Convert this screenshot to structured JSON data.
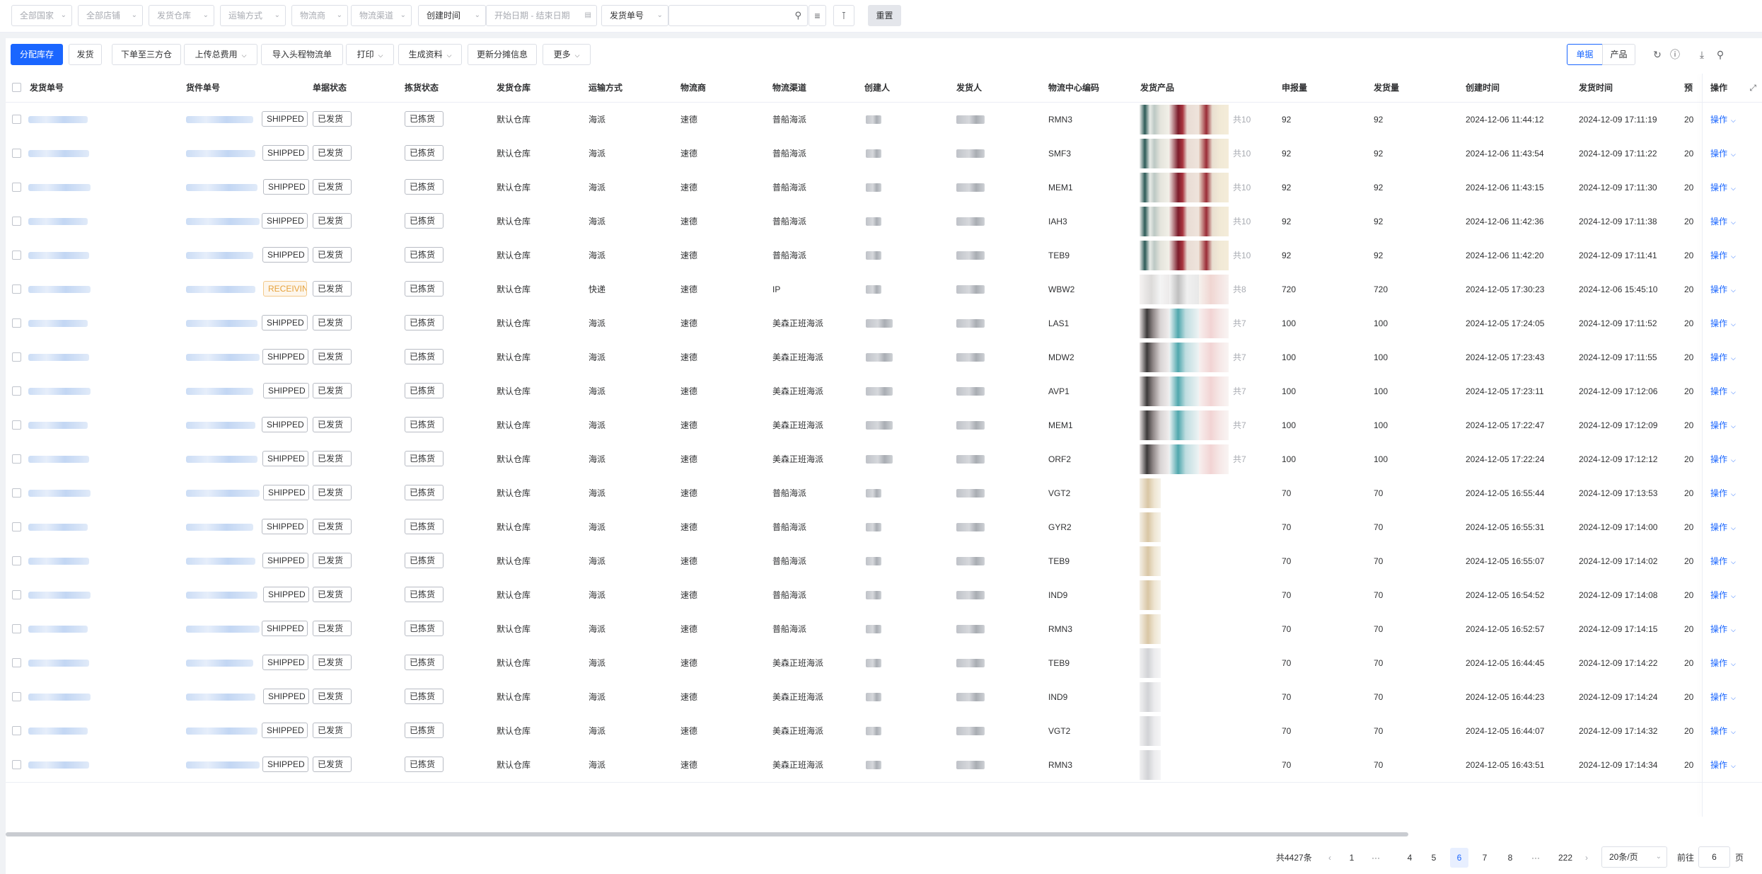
{
  "filters": {
    "country": "全部国家",
    "shop": "全部店铺",
    "warehouse": "发货仓库",
    "shipping_method": "运输方式",
    "carrier": "物流商",
    "channel": "物流渠道",
    "time_type": "创建时间",
    "date_range": "开始日期 - 结束日期",
    "search_field": "发货单号",
    "search_value": "",
    "reset": "重置"
  },
  "toolbar": {
    "allocate": "分配库存",
    "ship": "发货",
    "order_third": "下单至三方仓",
    "upload_fee": "上传总费用",
    "import_tracking": "导入头程物流单",
    "print": "打印",
    "generate": "生成资料",
    "update_split": "更新分摊信息",
    "more": "更多",
    "view_single": "单据",
    "view_product": "产品"
  },
  "columns": [
    "发货单号",
    "货件单号",
    "单据状态",
    "拣货状态",
    "发货仓库",
    "运输方式",
    "物流商",
    "物流渠道",
    "创建人",
    "发货人",
    "物流中心编码",
    "发货产品",
    "申报量",
    "发货量",
    "创建时间",
    "发货时间",
    "预",
    "操作"
  ],
  "row_action": "操作",
  "rows": [
    {
      "status": "SHIPPED",
      "doc_status": "已发货",
      "pick": "已拣货",
      "wh": "默认仓库",
      "method": "海派",
      "carrier": "速德",
      "channel": "普船海派",
      "center": "RMN3",
      "thumbs": [
        "t1",
        "t2",
        "t3"
      ],
      "count": "共10",
      "declared": "92",
      "shipped": "92",
      "created": "2024-12-06 11:44:12",
      "ship_time": "2024-12-09 17:11:19",
      "pre": "20"
    },
    {
      "status": "SHIPPED",
      "doc_status": "已发货",
      "pick": "已拣货",
      "wh": "默认仓库",
      "method": "海派",
      "carrier": "速德",
      "channel": "普船海派",
      "center": "SMF3",
      "thumbs": [
        "t1",
        "t2",
        "t3"
      ],
      "count": "共10",
      "declared": "92",
      "shipped": "92",
      "created": "2024-12-06 11:43:54",
      "ship_time": "2024-12-09 17:11:22",
      "pre": "20"
    },
    {
      "status": "SHIPPED",
      "doc_status": "已发货",
      "pick": "已拣货",
      "wh": "默认仓库",
      "method": "海派",
      "carrier": "速德",
      "channel": "普船海派",
      "center": "MEM1",
      "thumbs": [
        "t1",
        "t2",
        "t3"
      ],
      "count": "共10",
      "declared": "92",
      "shipped": "92",
      "created": "2024-12-06 11:43:15",
      "ship_time": "2024-12-09 17:11:30",
      "pre": "20"
    },
    {
      "status": "SHIPPED",
      "doc_status": "已发货",
      "pick": "已拣货",
      "wh": "默认仓库",
      "method": "海派",
      "carrier": "速德",
      "channel": "普船海派",
      "center": "IAH3",
      "thumbs": [
        "t1",
        "t2",
        "t3"
      ],
      "count": "共10",
      "declared": "92",
      "shipped": "92",
      "created": "2024-12-06 11:42:36",
      "ship_time": "2024-12-09 17:11:38",
      "pre": "20"
    },
    {
      "status": "SHIPPED",
      "doc_status": "已发货",
      "pick": "已拣货",
      "wh": "默认仓库",
      "method": "海派",
      "carrier": "速德",
      "channel": "普船海派",
      "center": "TEB9",
      "thumbs": [
        "t1",
        "t2",
        "t3"
      ],
      "count": "共10",
      "declared": "92",
      "shipped": "92",
      "created": "2024-12-06 11:42:20",
      "ship_time": "2024-12-09 17:11:41",
      "pre": "20"
    },
    {
      "status": "RECEIVIN",
      "doc_status": "已发货",
      "pick": "已拣货",
      "wh": "默认仓库",
      "method": "快递",
      "carrier": "速德",
      "channel": "IP",
      "center": "WBW2",
      "thumbs": [
        "t4",
        "t5",
        "t6"
      ],
      "count": "共8",
      "declared": "720",
      "shipped": "720",
      "created": "2024-12-05 17:30:23",
      "ship_time": "2024-12-06 15:45:10",
      "pre": "20"
    },
    {
      "status": "SHIPPED",
      "doc_status": "已发货",
      "pick": "已拣货",
      "wh": "默认仓库",
      "method": "海派",
      "carrier": "速德",
      "channel": "美森正班海派",
      "center": "LAS1",
      "thumbs": [
        "t7",
        "t8",
        "t9"
      ],
      "count": "共7",
      "declared": "100",
      "shipped": "100",
      "created": "2024-12-05 17:24:05",
      "ship_time": "2024-12-09 17:11:52",
      "pre": "20"
    },
    {
      "status": "SHIPPED",
      "doc_status": "已发货",
      "pick": "已拣货",
      "wh": "默认仓库",
      "method": "海派",
      "carrier": "速德",
      "channel": "美森正班海派",
      "center": "MDW2",
      "thumbs": [
        "t7",
        "t8",
        "t9"
      ],
      "count": "共7",
      "declared": "100",
      "shipped": "100",
      "created": "2024-12-05 17:23:43",
      "ship_time": "2024-12-09 17:11:55",
      "pre": "20"
    },
    {
      "status": "SHIPPED",
      "doc_status": "已发货",
      "pick": "已拣货",
      "wh": "默认仓库",
      "method": "海派",
      "carrier": "速德",
      "channel": "美森正班海派",
      "center": "AVP1",
      "thumbs": [
        "t7",
        "t8",
        "t9"
      ],
      "count": "共7",
      "declared": "100",
      "shipped": "100",
      "created": "2024-12-05 17:23:11",
      "ship_time": "2024-12-09 17:12:06",
      "pre": "20"
    },
    {
      "status": "SHIPPED",
      "doc_status": "已发货",
      "pick": "已拣货",
      "wh": "默认仓库",
      "method": "海派",
      "carrier": "速德",
      "channel": "美森正班海派",
      "center": "MEM1",
      "thumbs": [
        "t7",
        "t8",
        "t9"
      ],
      "count": "共7",
      "declared": "100",
      "shipped": "100",
      "created": "2024-12-05 17:22:47",
      "ship_time": "2024-12-09 17:12:09",
      "pre": "20"
    },
    {
      "status": "SHIPPED",
      "doc_status": "已发货",
      "pick": "已拣货",
      "wh": "默认仓库",
      "method": "海派",
      "carrier": "速德",
      "channel": "美森正班海派",
      "center": "ORF2",
      "thumbs": [
        "t7",
        "t8",
        "t9"
      ],
      "count": "共7",
      "declared": "100",
      "shipped": "100",
      "created": "2024-12-05 17:22:24",
      "ship_time": "2024-12-09 17:12:12",
      "pre": "20"
    },
    {
      "status": "SHIPPED",
      "doc_status": "已发货",
      "pick": "已拣货",
      "wh": "默认仓库",
      "method": "海派",
      "carrier": "速德",
      "channel": "普船海派",
      "center": "VGT2",
      "thumbs": [
        "t10"
      ],
      "count": "",
      "declared": "70",
      "shipped": "70",
      "created": "2024-12-05 16:55:44",
      "ship_time": "2024-12-09 17:13:53",
      "pre": "20"
    },
    {
      "status": "SHIPPED",
      "doc_status": "已发货",
      "pick": "已拣货",
      "wh": "默认仓库",
      "method": "海派",
      "carrier": "速德",
      "channel": "普船海派",
      "center": "GYR2",
      "thumbs": [
        "t10"
      ],
      "count": "",
      "declared": "70",
      "shipped": "70",
      "created": "2024-12-05 16:55:31",
      "ship_time": "2024-12-09 17:14:00",
      "pre": "20"
    },
    {
      "status": "SHIPPED",
      "doc_status": "已发货",
      "pick": "已拣货",
      "wh": "默认仓库",
      "method": "海派",
      "carrier": "速德",
      "channel": "普船海派",
      "center": "TEB9",
      "thumbs": [
        "t10"
      ],
      "count": "",
      "declared": "70",
      "shipped": "70",
      "created": "2024-12-05 16:55:07",
      "ship_time": "2024-12-09 17:14:02",
      "pre": "20"
    },
    {
      "status": "SHIPPED",
      "doc_status": "已发货",
      "pick": "已拣货",
      "wh": "默认仓库",
      "method": "海派",
      "carrier": "速德",
      "channel": "普船海派",
      "center": "IND9",
      "thumbs": [
        "t10"
      ],
      "count": "",
      "declared": "70",
      "shipped": "70",
      "created": "2024-12-05 16:54:52",
      "ship_time": "2024-12-09 17:14:08",
      "pre": "20"
    },
    {
      "status": "SHIPPED",
      "doc_status": "已发货",
      "pick": "已拣货",
      "wh": "默认仓库",
      "method": "海派",
      "carrier": "速德",
      "channel": "普船海派",
      "center": "RMN3",
      "thumbs": [
        "t10"
      ],
      "count": "",
      "declared": "70",
      "shipped": "70",
      "created": "2024-12-05 16:52:57",
      "ship_time": "2024-12-09 17:14:15",
      "pre": "20"
    },
    {
      "status": "SHIPPED",
      "doc_status": "已发货",
      "pick": "已拣货",
      "wh": "默认仓库",
      "method": "海派",
      "carrier": "速德",
      "channel": "美森正班海派",
      "center": "TEB9",
      "thumbs": [
        "t11"
      ],
      "count": "",
      "declared": "70",
      "shipped": "70",
      "created": "2024-12-05 16:44:45",
      "ship_time": "2024-12-09 17:14:22",
      "pre": "20"
    },
    {
      "status": "SHIPPED",
      "doc_status": "已发货",
      "pick": "已拣货",
      "wh": "默认仓库",
      "method": "海派",
      "carrier": "速德",
      "channel": "美森正班海派",
      "center": "IND9",
      "thumbs": [
        "t11"
      ],
      "count": "",
      "declared": "70",
      "shipped": "70",
      "created": "2024-12-05 16:44:23",
      "ship_time": "2024-12-09 17:14:24",
      "pre": "20"
    },
    {
      "status": "SHIPPED",
      "doc_status": "已发货",
      "pick": "已拣货",
      "wh": "默认仓库",
      "method": "海派",
      "carrier": "速德",
      "channel": "美森正班海派",
      "center": "VGT2",
      "thumbs": [
        "t11"
      ],
      "count": "",
      "declared": "70",
      "shipped": "70",
      "created": "2024-12-05 16:44:07",
      "ship_time": "2024-12-09 17:14:32",
      "pre": "20"
    },
    {
      "status": "SHIPPED",
      "doc_status": "已发货",
      "pick": "已拣货",
      "wh": "默认仓库",
      "method": "海派",
      "carrier": "速德",
      "channel": "美森正班海派",
      "center": "RMN3",
      "thumbs": [
        "t11"
      ],
      "count": "",
      "declared": "70",
      "shipped": "70",
      "created": "2024-12-05 16:43:51",
      "ship_time": "2024-12-09 17:14:34",
      "pre": "20"
    }
  ],
  "pagination": {
    "total": "共4427条",
    "pages": [
      "1",
      "···",
      "4",
      "5",
      "6",
      "7",
      "8",
      "···",
      "222"
    ],
    "current": "6",
    "page_size": "20条/页",
    "goto_label": "前往",
    "goto_value": "6",
    "page_suffix": "页"
  }
}
